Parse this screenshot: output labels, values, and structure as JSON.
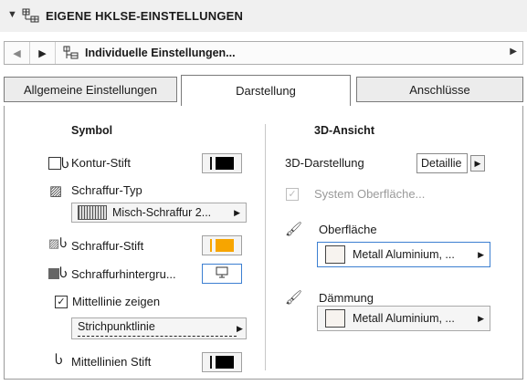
{
  "window": {
    "title": "EIGENE HKLSE-EINSTELLUNGEN",
    "collapse_icon": "chevron-down-icon"
  },
  "navigation": {
    "prev_icon": "triangle-left-icon",
    "next_icon": "triangle-right-icon",
    "favorites_label": "Individuelle Einstellungen...",
    "expand_icon": "triangle-right-icon"
  },
  "tabs": [
    {
      "label": "Allgemeine Einstellungen",
      "active": false
    },
    {
      "label": "Darstellung",
      "active": true
    },
    {
      "label": "Anschlüsse",
      "active": false
    }
  ],
  "symbol": {
    "heading": "Symbol",
    "kontur_stift": {
      "label": "Kontur-Stift",
      "color": "#000000"
    },
    "schraffur_typ": {
      "label": "Schraffur-Typ",
      "value": "Misch-Schraffur 2..."
    },
    "schraffur_stift": {
      "label": "Schraffur-Stift",
      "color": "#f7a500"
    },
    "schraffur_hintergrund": {
      "label": "Schraffurhintergru...",
      "button_icon": "monitor-icon"
    },
    "mittellinie_zeigen": {
      "label": "Mittellinie zeigen",
      "checked": true
    },
    "linientyp": {
      "value": "Strichpunktlinie"
    },
    "mittellinien_stift": {
      "label": "Mittellinien Stift",
      "color": "#000000"
    }
  },
  "ansicht3d": {
    "heading": "3D-Ansicht",
    "darstellung": {
      "label": "3D-Darstellung",
      "value": "Detaillie"
    },
    "system_oberflaeche": {
      "label": "System Oberfläche...",
      "checked": true,
      "enabled": false
    },
    "oberflaeche": {
      "label": "Oberfläche",
      "value": "Metall Aluminium, ...",
      "swatch": "#f7f3ef"
    },
    "daemmung": {
      "label": "Dämmung",
      "value": "Metall Aluminium, ...",
      "swatch": "#f7f3ef"
    }
  }
}
